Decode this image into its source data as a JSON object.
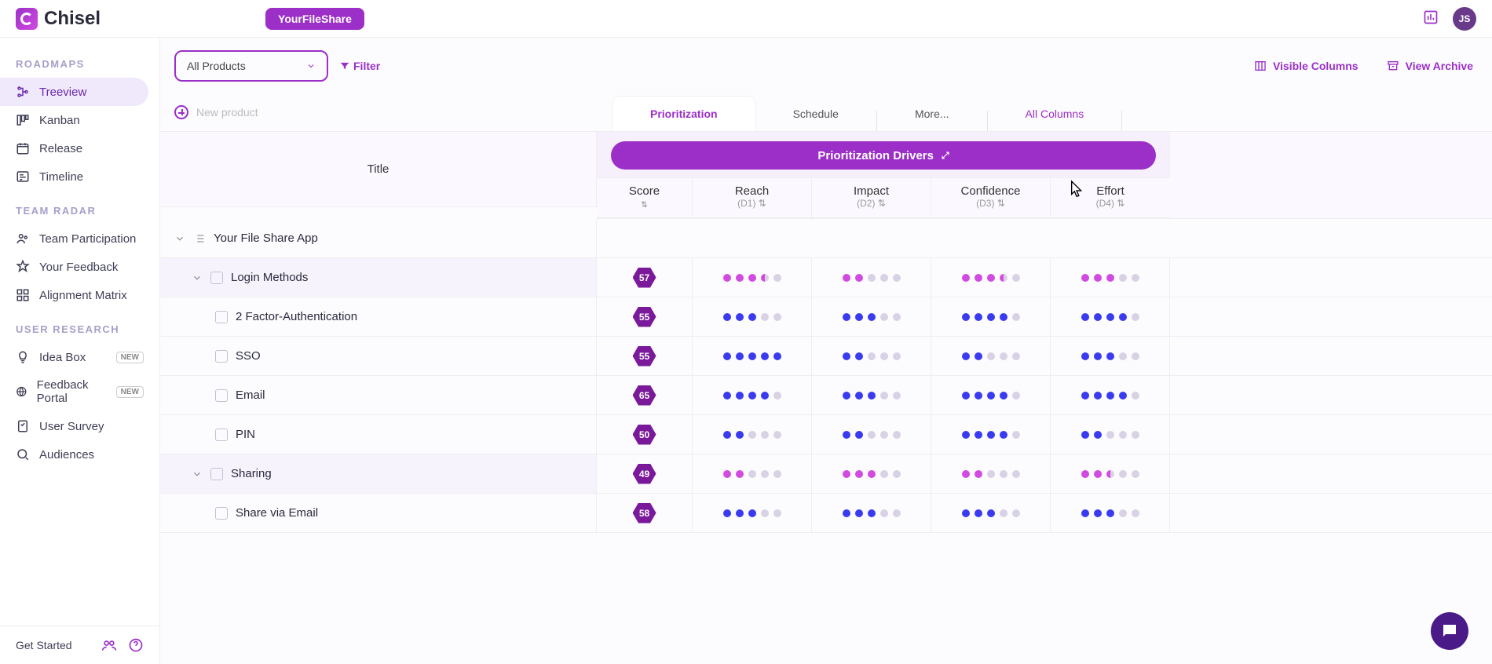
{
  "app": {
    "name": "Chisel",
    "workspace": "YourFileShare",
    "avatar": "JS"
  },
  "sidebar": {
    "sections": {
      "roadmaps": {
        "label": "ROADMAPS",
        "items": [
          "Treeview",
          "Kanban",
          "Release",
          "Timeline"
        ]
      },
      "teamradar": {
        "label": "TEAM RADAR",
        "items": [
          "Team Participation",
          "Your Feedback",
          "Alignment Matrix"
        ]
      },
      "userresearch": {
        "label": "USER RESEARCH",
        "items": [
          "Idea Box",
          "Feedback Portal",
          "User Survey",
          "Audiences"
        ]
      }
    },
    "new_badge": "NEW",
    "get_started": "Get Started"
  },
  "toolbar": {
    "product_select": "All Products",
    "filter": "Filter",
    "visible_columns": "Visible Columns",
    "view_archive": "View Archive"
  },
  "newproduct": "New product",
  "tabs": {
    "prioritization": "Prioritization",
    "schedule": "Schedule",
    "more": "More...",
    "allcolumns": "All Columns"
  },
  "drivers_label": "Prioritization Drivers",
  "columns": {
    "title": "Title",
    "score": "Score",
    "reach": {
      "name": "Reach",
      "sub": "(D1)"
    },
    "impact": {
      "name": "Impact",
      "sub": "(D2)"
    },
    "confidence": {
      "name": "Confidence",
      "sub": "(D3)"
    },
    "effort": {
      "name": "Effort",
      "sub": "(D4)"
    }
  },
  "treeRoot": "Your File Share App",
  "rows": [
    {
      "type": "group",
      "title": "Login Methods",
      "score": "57",
      "color": "pk",
      "dots": {
        "reach": [
          1,
          1,
          1,
          0.5,
          0
        ],
        "impact": [
          1,
          1,
          0,
          0,
          0
        ],
        "confidence": [
          1,
          1,
          1,
          0.5,
          0
        ],
        "effort": [
          1,
          1,
          1,
          0,
          0
        ]
      }
    },
    {
      "type": "item",
      "title": "2 Factor-Authentication",
      "score": "55",
      "color": "on",
      "dots": {
        "reach": [
          1,
          1,
          1,
          0,
          0
        ],
        "impact": [
          1,
          1,
          1,
          0,
          0
        ],
        "confidence": [
          1,
          1,
          1,
          1,
          0
        ],
        "effort": [
          1,
          1,
          1,
          1,
          0
        ]
      }
    },
    {
      "type": "item",
      "title": "SSO",
      "score": "55",
      "color": "on",
      "dots": {
        "reach": [
          1,
          1,
          1,
          1,
          1
        ],
        "impact": [
          1,
          1,
          0,
          0,
          0
        ],
        "confidence": [
          1,
          1,
          0,
          0,
          0
        ],
        "effort": [
          1,
          1,
          1,
          0,
          0
        ]
      }
    },
    {
      "type": "item",
      "title": "Email",
      "score": "65",
      "color": "on",
      "dots": {
        "reach": [
          1,
          1,
          1,
          1,
          0
        ],
        "impact": [
          1,
          1,
          1,
          0,
          0
        ],
        "confidence": [
          1,
          1,
          1,
          1,
          0
        ],
        "effort": [
          1,
          1,
          1,
          1,
          0
        ]
      }
    },
    {
      "type": "item",
      "title": "PIN",
      "score": "50",
      "color": "on",
      "dots": {
        "reach": [
          1,
          1,
          0,
          0,
          0
        ],
        "impact": [
          1,
          1,
          0,
          0,
          0
        ],
        "confidence": [
          1,
          1,
          1,
          1,
          0
        ],
        "effort": [
          1,
          1,
          0,
          0,
          0
        ]
      }
    },
    {
      "type": "group",
      "title": "Sharing",
      "score": "49",
      "color": "pk",
      "dots": {
        "reach": [
          1,
          1,
          0,
          0,
          0
        ],
        "impact": [
          1,
          1,
          1,
          0,
          0
        ],
        "confidence": [
          1,
          1,
          0,
          0,
          0
        ],
        "effort": [
          1,
          1,
          0.5,
          0,
          0
        ]
      }
    },
    {
      "type": "item",
      "title": "Share via Email",
      "score": "58",
      "color": "on",
      "dots": {
        "reach": [
          1,
          1,
          1,
          0,
          0
        ],
        "impact": [
          1,
          1,
          1,
          0,
          0
        ],
        "confidence": [
          1,
          1,
          1,
          0,
          0
        ],
        "effort": [
          1,
          1,
          1,
          0,
          0
        ]
      }
    }
  ]
}
